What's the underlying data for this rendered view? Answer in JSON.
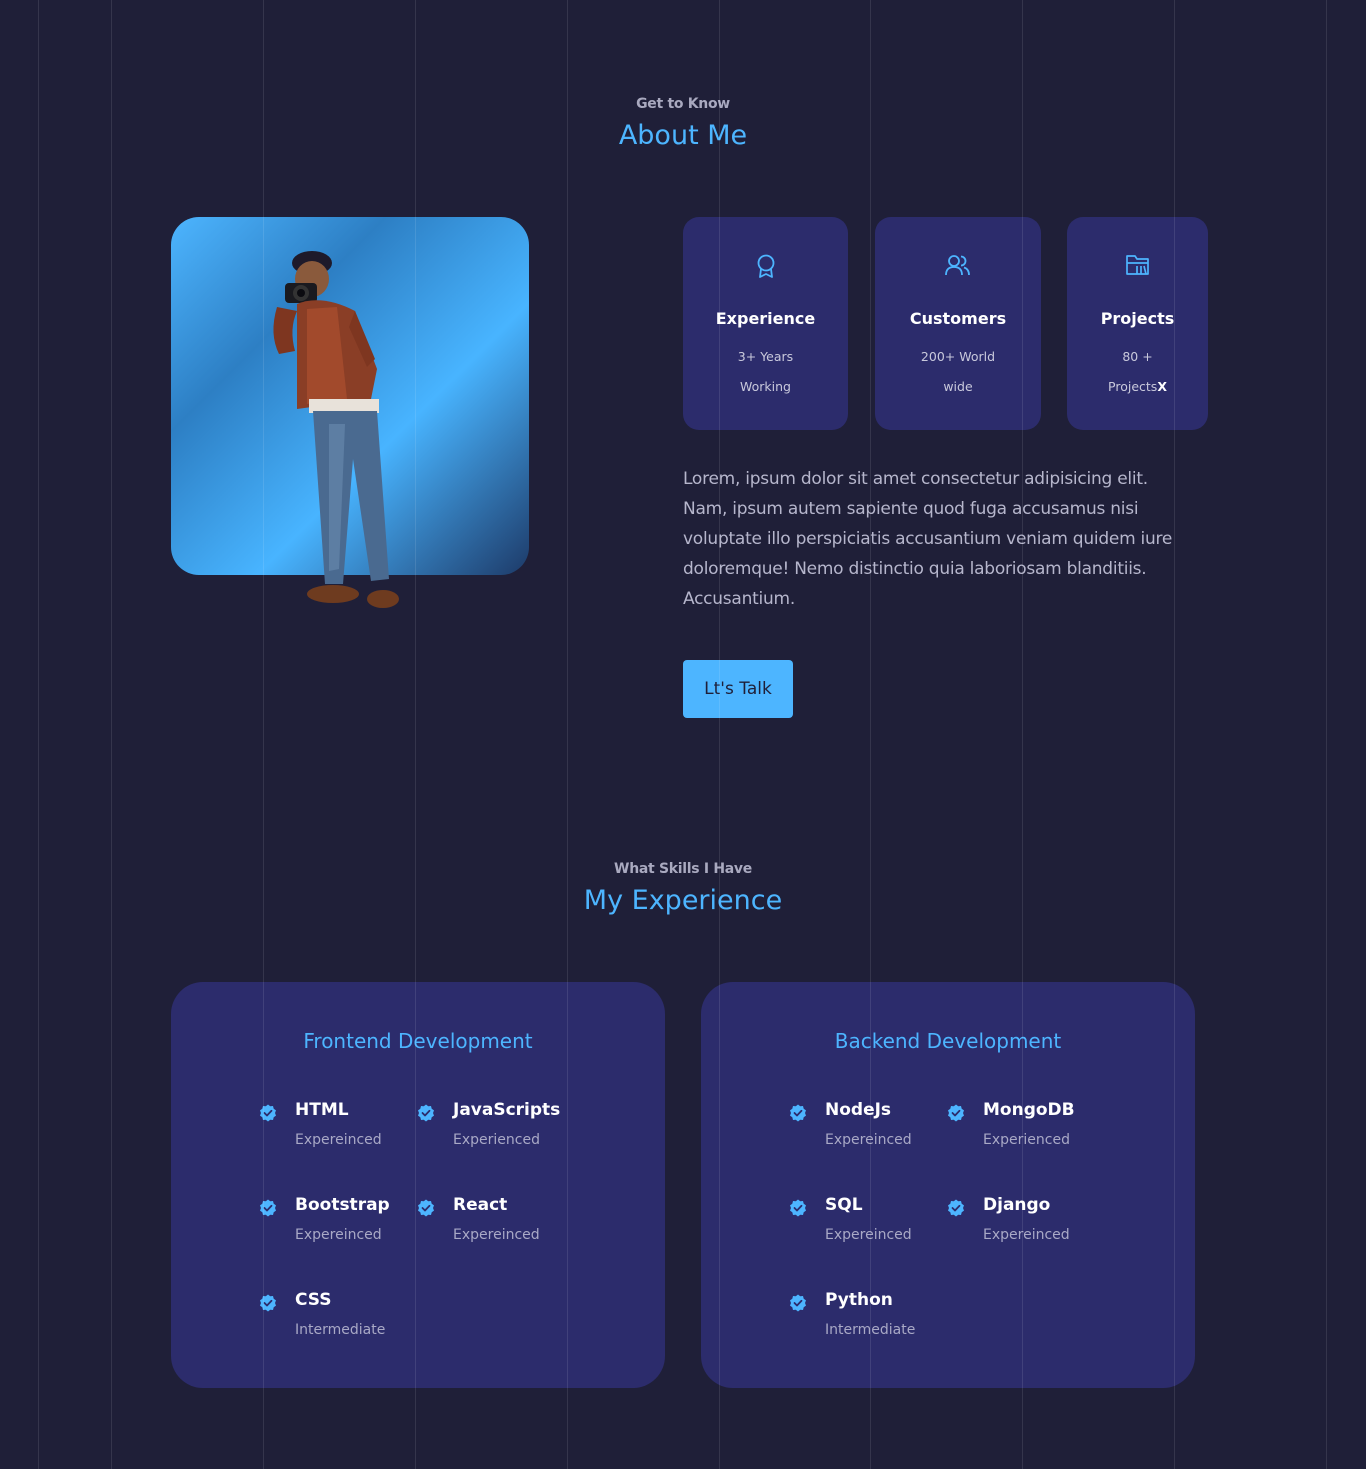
{
  "about": {
    "eyebrow": "Get to Know",
    "title": "About Me",
    "cards": [
      {
        "icon": "award-icon",
        "title": "Experience",
        "line1": "3+ Years",
        "line2": "Working",
        "suffix": ""
      },
      {
        "icon": "users-icon",
        "title": "Customers",
        "line1": "200+ World",
        "line2": "wide",
        "suffix": ""
      },
      {
        "icon": "folder-icon",
        "title": "Projects",
        "line1": "80 +",
        "line2": "Projects",
        "suffix": "X"
      }
    ],
    "text": "Lorem, ipsum dolor sit amet consectetur adipisicing elit. Nam, ipsum autem sapiente quod fuga accusamus nisi voluptate illo perspiciatis accusantium veniam quidem iure doloremque! Nemo distinctio quia laboriosam blanditiis. Accusantium.",
    "button": "Lt's Talk"
  },
  "experience": {
    "eyebrow": "What Skills I Have",
    "title": "My Experience",
    "frontend": {
      "title": "Frontend Development",
      "skills": [
        {
          "name": "HTML",
          "level": "Expereinced"
        },
        {
          "name": "JavaScripts",
          "level": "Experienced"
        },
        {
          "name": "Bootstrap",
          "level": "Expereinced"
        },
        {
          "name": "React",
          "level": "Expereinced"
        },
        {
          "name": "CSS",
          "level": "Intermediate"
        }
      ]
    },
    "backend": {
      "title": "Backend Development",
      "skills": [
        {
          "name": "NodeJs",
          "level": "Expereinced"
        },
        {
          "name": "MongoDB",
          "level": "Experienced"
        },
        {
          "name": "SQL",
          "level": "Expereinced"
        },
        {
          "name": "Django",
          "level": "Expereinced"
        },
        {
          "name": "Python",
          "level": "Intermediate"
        }
      ]
    }
  },
  "colors": {
    "background": "#1f1f38",
    "card": "#2c2c6c",
    "accent": "#4db5ff"
  }
}
